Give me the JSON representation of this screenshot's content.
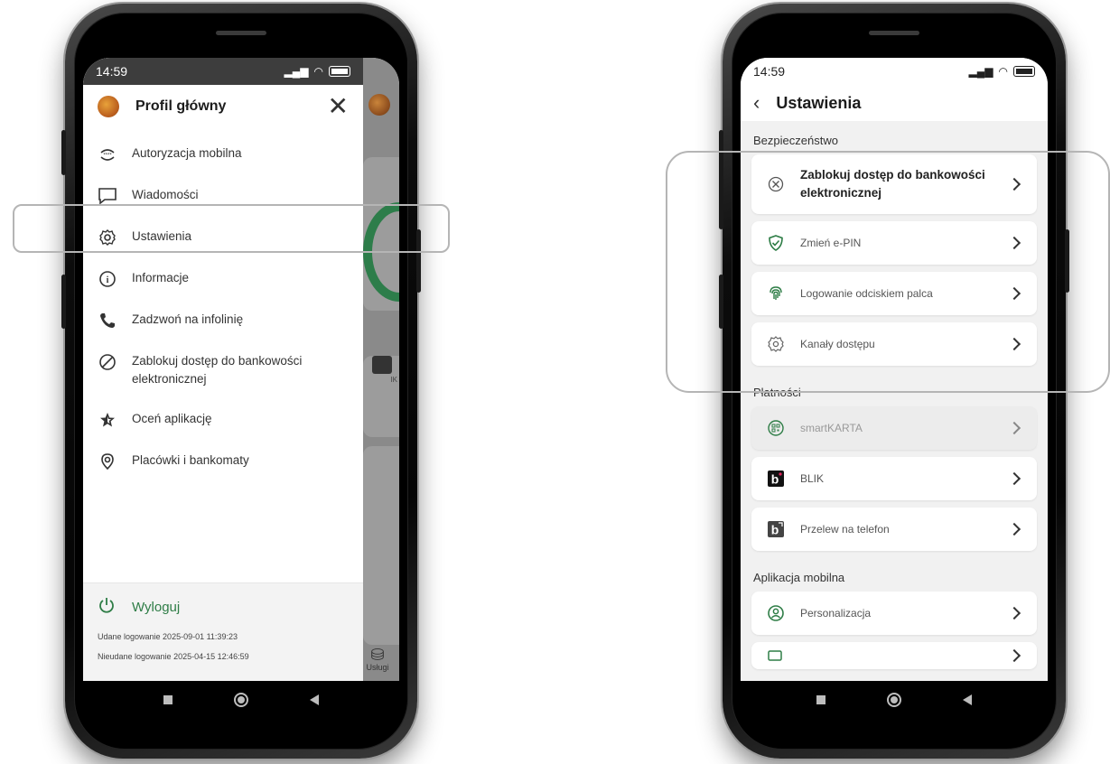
{
  "left_phone": {
    "status": {
      "time": "14:59"
    },
    "drawer": {
      "title": "Profil główny",
      "items": [
        {
          "label": "Autoryzacja mobilna",
          "icon": "mobile-authorization-icon"
        },
        {
          "label": "Wiadomości",
          "icon": "message-icon"
        },
        {
          "label": "Ustawienia",
          "icon": "gear-icon"
        },
        {
          "label": "Informacje",
          "icon": "info-icon"
        },
        {
          "label": "Zadzwoń na infolinię",
          "icon": "phone-icon"
        },
        {
          "label": "Zablokuj dostęp do bankowości elektronicznej",
          "icon": "block-icon"
        },
        {
          "label": "Oceń aplikację",
          "icon": "star-icon"
        },
        {
          "label": "Placówki i bankomaty",
          "icon": "location-icon"
        }
      ],
      "logout": "Wyloguj",
      "last_login_ok": "Udane logowanie 2025-09-01 11:39:23",
      "last_login_fail": "Nieudane logowanie 2025-04-15 12:46:59"
    },
    "peek": {
      "uslugi": "Usługi",
      "blik": "IK"
    }
  },
  "right_phone": {
    "status": {
      "time": "14:59"
    },
    "header": {
      "title": "Ustawienia"
    },
    "sections": [
      {
        "label": "Bezpieczeństwo",
        "items": [
          {
            "label": "Zablokuj dostęp do bankowości elektronicznej",
            "icon": "circle-x-icon"
          },
          {
            "label": "Zmień e-PIN",
            "icon": "shield-check-icon"
          },
          {
            "label": "Logowanie odciskiem palca",
            "icon": "fingerprint-icon"
          },
          {
            "label": "Kanały dostępu",
            "icon": "gear-icon"
          }
        ]
      },
      {
        "label": "Płatności",
        "items": [
          {
            "label": "smartKARTA",
            "icon": "qr-code-icon"
          },
          {
            "label": "BLIK",
            "icon": "blik-icon"
          },
          {
            "label": "Przelew na telefon",
            "icon": "blik-phone-transfer-icon"
          }
        ]
      },
      {
        "label": "Aplikacja mobilna",
        "items": [
          {
            "label": "Personalizacja",
            "icon": "user-circle-icon"
          }
        ]
      }
    ]
  },
  "colors": {
    "accent_green": "#2e7d46",
    "highlight": "#b5b5b5"
  }
}
